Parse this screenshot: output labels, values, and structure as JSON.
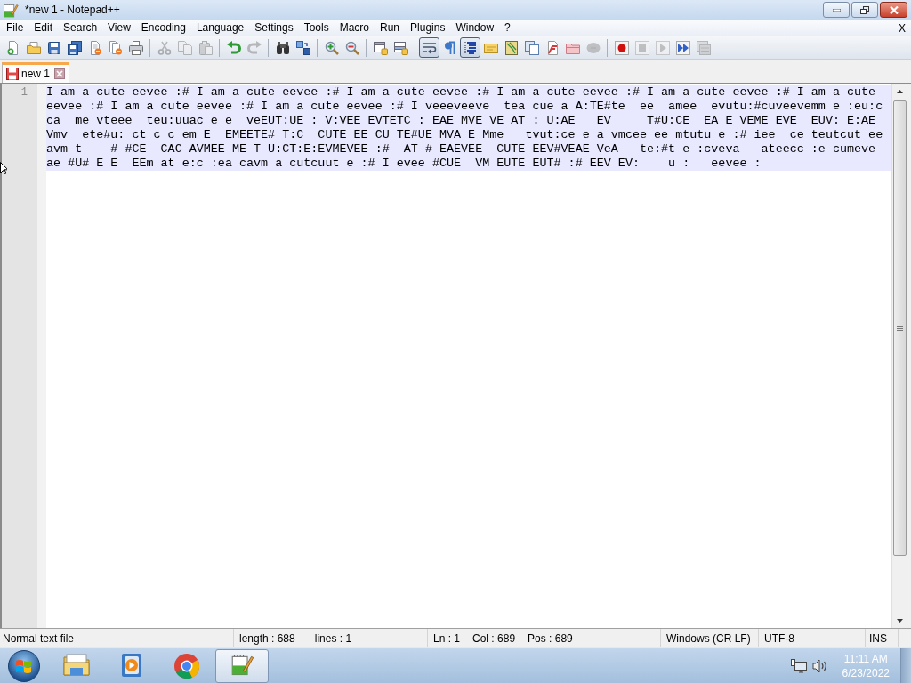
{
  "window": {
    "title": "*new 1 - Notepad++"
  },
  "menu": {
    "items": [
      "File",
      "Edit",
      "Search",
      "View",
      "Encoding",
      "Language",
      "Settings",
      "Tools",
      "Macro",
      "Run",
      "Plugins",
      "Window",
      "?"
    ],
    "close_label": "X"
  },
  "toolbar": {
    "groups": [
      {
        "buttons": [
          {
            "disabled": false,
            "pressed": false
          },
          {
            "disabled": false,
            "pressed": false
          },
          {
            "disabled": false,
            "pressed": false
          },
          {
            "disabled": false,
            "pressed": false
          },
          {
            "disabled": false,
            "pressed": false
          },
          {
            "disabled": false,
            "pressed": false
          },
          {
            "disabled": false,
            "pressed": false
          }
        ]
      },
      {
        "buttons": [
          {
            "disabled": true,
            "pressed": false
          },
          {
            "disabled": true,
            "pressed": false
          },
          {
            "disabled": true,
            "pressed": false
          }
        ]
      },
      {
        "buttons": [
          {
            "disabled": false,
            "pressed": false
          },
          {
            "disabled": true,
            "pressed": false
          }
        ]
      },
      {
        "buttons": [
          {
            "disabled": false,
            "pressed": false
          },
          {
            "disabled": false,
            "pressed": false
          }
        ]
      },
      {
        "buttons": [
          {
            "disabled": false,
            "pressed": false
          },
          {
            "disabled": false,
            "pressed": false
          }
        ]
      },
      {
        "buttons": [
          {
            "disabled": false,
            "pressed": false
          },
          {
            "disabled": false,
            "pressed": false
          }
        ]
      },
      {
        "buttons": [
          {
            "disabled": false,
            "pressed": true
          },
          {
            "disabled": false,
            "pressed": false
          },
          {
            "disabled": false,
            "pressed": true
          },
          {
            "disabled": false,
            "pressed": false
          },
          {
            "disabled": false,
            "pressed": false
          },
          {
            "disabled": false,
            "pressed": false
          },
          {
            "disabled": false,
            "pressed": false
          },
          {
            "disabled": false,
            "pressed": false
          },
          {
            "disabled": true,
            "pressed": false
          }
        ]
      },
      {
        "buttons": [
          {
            "disabled": false,
            "pressed": false
          },
          {
            "disabled": true,
            "pressed": false
          },
          {
            "disabled": true,
            "pressed": false
          },
          {
            "disabled": false,
            "pressed": false
          },
          {
            "disabled": true,
            "pressed": false
          }
        ]
      }
    ]
  },
  "tabs": [
    {
      "label": "new 1",
      "selected": true,
      "modified": true
    }
  ],
  "editor": {
    "lines": [
      {
        "number": "1",
        "current": true,
        "wrapped": [
          "I am a cute eevee :# I am a cute eevee :# I am a cute eevee :# I am a cute eevee :# I am a cute eevee :# I am a cute",
          "eevee :# I am a cute eevee :# I am a cute eevee :# I veeeveeve  tea cue a A:TE#te  ee  amee  evutu:#cuveevemm e :eu:c",
          "ca  me vteee  teu:uuac e e  veEUT:UE : V:VEE EVTETC : EAE MVE VE AT : U:AE   EV     T#U:CE  EA E VEME EVE  EUV: E:AE",
          "Vmv  ete#u: ct c c em E  EMEETE# T:C  CUTE EE CU TE#UE MVA E Mme   tvut:ce e a vmcee ee mtutu e :# iee  ce teutcut ee",
          "avm t    # #CE  CAC AVMEE ME T U:CT:E:EVMEVEE :#  AT # EAEVEE  CUTE EEV#VEAE VeA   te:#t e :cveva   ateecc :e cumeve",
          "ae #U# E E  EEm at e:c :ea cavm a cutcuut e :# I evee #CUE  VM EUTE EUT# :# EEV EV:    u :   eevee :"
        ]
      }
    ]
  },
  "status_bar": {
    "panels": [
      {
        "texts": [
          "Normal text file"
        ]
      },
      {
        "texts": [
          "length : 688",
          "lines : 1"
        ]
      },
      {
        "texts": [
          "Ln : 1",
          "Col : 689",
          "Pos : 689"
        ]
      },
      {
        "texts": [
          "Windows (CR LF)"
        ]
      },
      {
        "texts": [
          "UTF-8"
        ]
      },
      {
        "texts": [
          "INS"
        ]
      }
    ]
  },
  "taskbar": {
    "apps": [
      {
        "active": false
      },
      {
        "active": false
      },
      {
        "active": false
      },
      {
        "active": true
      }
    ],
    "clock": {
      "time": "11:11 AM",
      "date": "6/23/2022"
    }
  }
}
